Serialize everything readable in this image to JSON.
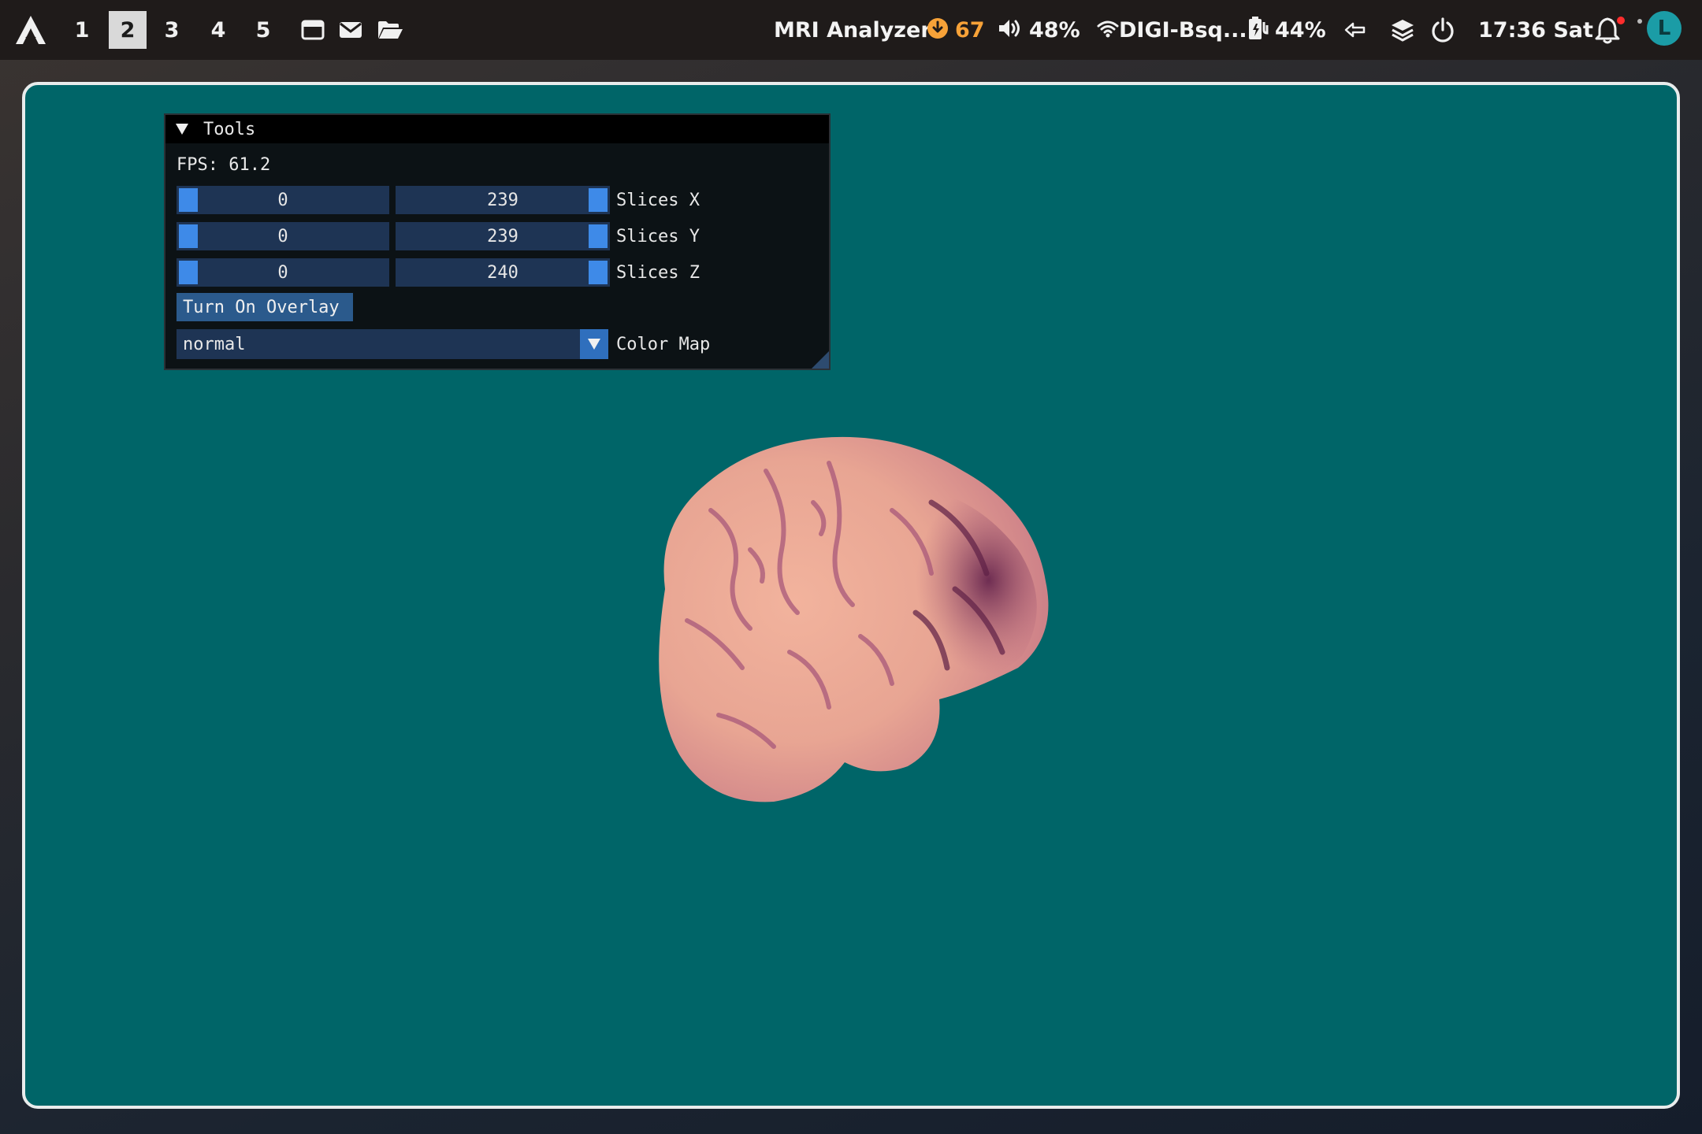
{
  "topbar": {
    "workspaces": [
      "1",
      "2",
      "3",
      "4",
      "5"
    ],
    "active_workspace": "2",
    "app_title": "MRI Analyzer",
    "updates": "67",
    "volume": "48%",
    "wifi": "DIGI-Bsq...",
    "battery": "44%",
    "clock": "17:36 Sat",
    "avatar_letter": "L",
    "colors": {
      "bar": "#1f1b1a",
      "updates": "#f7a238",
      "avatar": "#1b9ca6",
      "notification_dot": "#ff2d2d"
    }
  },
  "window": {
    "background": "#006568"
  },
  "tools": {
    "title": "Tools",
    "fps": "FPS: 61.2",
    "sliders": [
      {
        "min": "0",
        "max": "239",
        "label": "Slices X"
      },
      {
        "min": "0",
        "max": "239",
        "label": "Slices Y"
      },
      {
        "min": "0",
        "max": "240",
        "label": "Slices Z"
      }
    ],
    "overlay_button": "Turn On Overlay",
    "colormap_value": "normal",
    "colormap_label": "Color Map"
  }
}
